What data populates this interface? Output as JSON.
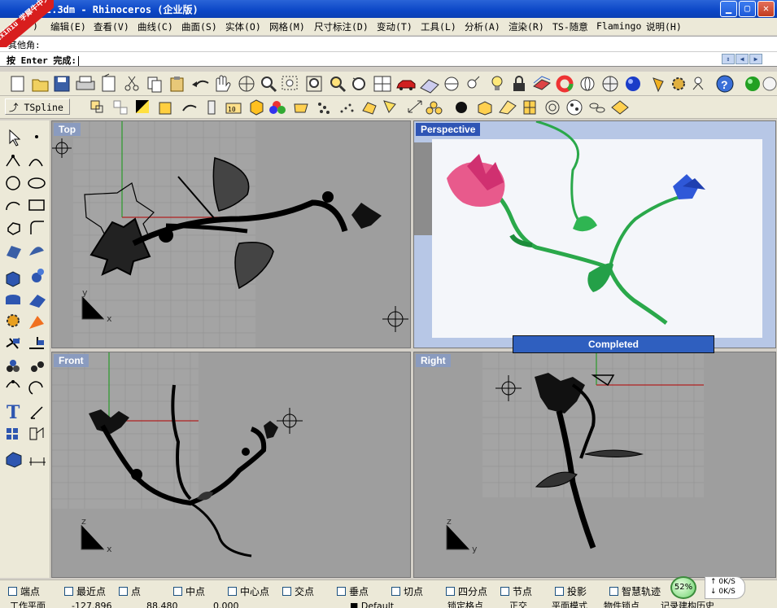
{
  "window": {
    "title": "2.3dm - Rhinoceros (企业版)"
  },
  "watermark": {
    "text": "xuexiniu 学犀牛中文网"
  },
  "menu": [
    "编辑(E)",
    "查看(V)",
    "曲线(C)",
    "曲面(S)",
    "实体(O)",
    "网格(M)",
    "尺寸标注(D)",
    "变动(T)",
    "工具(L)",
    "分析(A)",
    "渲染(R)",
    "TS-随意",
    "Flamingo",
    "说明(H)"
  ],
  "menu_fragment": ")",
  "command": {
    "history_line": "其他角:",
    "prompt": "按 Enter 完成:"
  },
  "toolbar2": {
    "tspline_label": "TSpline"
  },
  "viewports": {
    "top": {
      "label": "Top",
      "axis_x": "x",
      "axis_y": "y"
    },
    "perspective": {
      "label": "Perspective"
    },
    "front": {
      "label": "Front",
      "axis_x": "x",
      "axis_y": "z"
    },
    "right": {
      "label": "Right",
      "axis_x": "y",
      "axis_y": "z"
    }
  },
  "progress": {
    "text": "Completed"
  },
  "osnaps": [
    "端点",
    "最近点",
    "点",
    "中点",
    "中心点",
    "交点",
    "垂点",
    "切点",
    "四分点",
    "节点",
    "投影",
    "智慧轨迹"
  ],
  "statusbar": {
    "plane": "工作平面",
    "x": "-127.896",
    "y": "88.480",
    "z": "0.000",
    "layer": "Default",
    "grid_snap": "锁定格点",
    "ortho": "正交",
    "planar": "平面模式",
    "osnap": "物件锁点",
    "history": "记录建构历史"
  },
  "network": {
    "percent": "52%",
    "up": "0K/S",
    "down": "0K/S"
  },
  "colors": {
    "titlebar": "#0b46c6",
    "viewport_bg": "#9e9e9e",
    "active_label": "#2f55b5",
    "progress": "#2f5fbf"
  }
}
